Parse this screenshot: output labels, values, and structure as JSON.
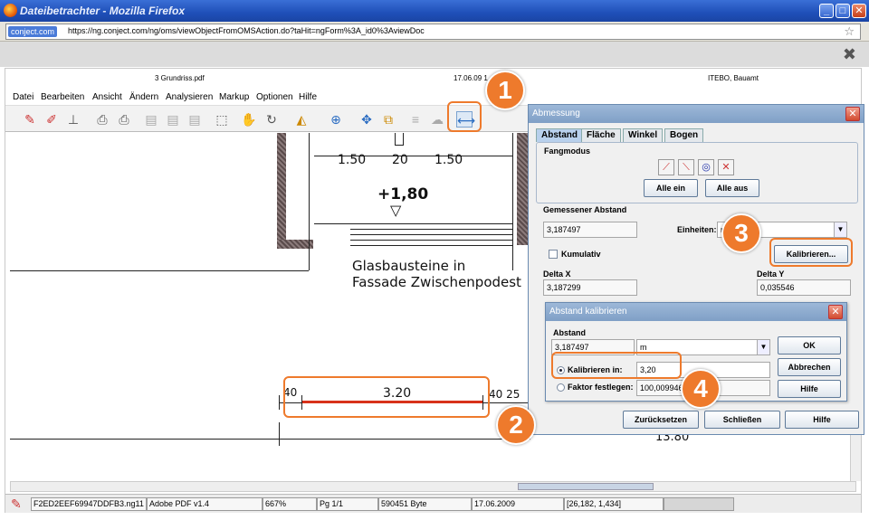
{
  "browser": {
    "title": "Dateibetrachter - Mozilla Firefox",
    "site_badge": "conject.com",
    "url": "https://ng.conject.com/ng/oms/viewObjectFromOMSAction.do?taHit=ngForm%3A_id0%3AviewDoc",
    "buttons": {
      "minimize": "_",
      "maximize": "□",
      "close": "✕"
    },
    "close_glyph": "✖"
  },
  "viewer": {
    "header": {
      "filename": "3 Grundriss.pdf",
      "date": "17.06.09 1",
      "company": "ITEBO, Bauamt"
    },
    "menu": [
      "Datei",
      "Bearbeiten",
      "Ansicht",
      "Ändern",
      "Analysieren",
      "Markup",
      "Optionen",
      "Hilfe"
    ],
    "drawing": {
      "dim1": "1.50",
      "dim2": "20",
      "dim3": "1.50",
      "level": "+1,80",
      "level_marker": "▽",
      "note_line1": "Glasbausteine in",
      "note_line2": "Fassade Zwischenpodest",
      "measure_left": "40",
      "measure_value": "3.20",
      "measure_right": "40 25",
      "bottom_dim": "13.80"
    },
    "status": {
      "file": "F2ED2EEF69947DDFB3.ng11",
      "format": "Adobe PDF v1.4",
      "zoom": "667%",
      "page": "Pg 1/1",
      "size": "590451 Byte",
      "date": "17.06.2009",
      "coords": "[26,182, 1,434]"
    }
  },
  "abmessung": {
    "title": "Abmessung",
    "tabs": [
      "Abstand",
      "Fläche",
      "Winkel",
      "Bogen"
    ],
    "fangmodus_label": "Fangmodus",
    "btn_alle_ein": "Alle ein",
    "btn_alle_aus": "Alle aus",
    "gemessener_label": "Gemessener Abstand",
    "gemessener_value": "3,187497",
    "einheiten_label": "Einheiten:",
    "einheiten_value": "m",
    "kumulativ_label": "Kumulativ",
    "btn_kalibrieren": "Kalibrieren...",
    "delta_x_label": "Delta X",
    "delta_x_value": "3,187299",
    "delta_y_label": "Delta Y",
    "delta_y_value": "0,035546",
    "btn_zuruecksetzen": "Zurücksetzen",
    "btn_schliessen": "Schließen",
    "btn_hilfe": "Hilfe"
  },
  "kalibrieren": {
    "title": "Abstand kalibrieren",
    "abstand_label": "Abstand",
    "abstand_value": "3,187497",
    "unit_value": "m",
    "radio1_label": "Kalibrieren in:",
    "radio1_value": "3,20",
    "radio2_label": "Faktor festlegen:",
    "radio2_value": "100,009946",
    "btn_ok": "OK",
    "btn_abbrechen": "Abbrechen",
    "btn_hilfe": "Hilfe"
  },
  "callouts": [
    "1",
    "2",
    "3",
    "4"
  ],
  "colors": {
    "accent": "#ee7a2c",
    "measure_line": "#d8321a",
    "title_blue": "#2456c4"
  }
}
